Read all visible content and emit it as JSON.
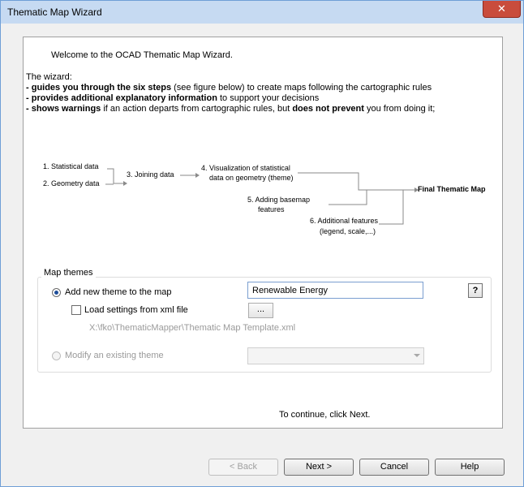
{
  "window": {
    "title": "Thematic Map Wizard",
    "close_glyph": "✕"
  },
  "welcome": "Welcome to the OCAD Thematic Map Wizard.",
  "intro": {
    "heading": "The wizard:",
    "line1_bold": "- guides you through the six steps",
    "line1_rest": " (see figure below) to create maps following the cartographic rules",
    "line2_bold": "- provides additional explanatory information",
    "line2_rest": " to support your decisions",
    "line3_bold1": "- shows warnings",
    "line3_mid": " if an action departs from cartographic rules, but ",
    "line3_bold2": "does not prevent",
    "line3_rest": " you from doing it;"
  },
  "diagram": {
    "step1": "1. Statistical data",
    "step2": "2. Geometry data",
    "step3": "3. Joining data",
    "step4_line1": "4. Visualization of statistical",
    "step4_line2": "data on geometry (theme)",
    "step5_line1": "5. Adding basemap",
    "step5_line2": "features",
    "step6_line1": "6. Additional features",
    "step6_line2": "(legend, scale,...)",
    "final": "Final Thematic Map"
  },
  "map_themes": {
    "legend": "Map themes",
    "add_new_label": "Add new theme to the map",
    "add_new_checked": true,
    "theme_name_value": "Renewable Energy",
    "help_label": "?",
    "load_settings_label": "Load settings from xml file",
    "load_settings_checked": false,
    "browse_label": "...",
    "template_path": "X:\\fko\\ThematicMapper\\Thematic Map Template.xml",
    "modify_label": "Modify an existing theme",
    "modify_checked": false,
    "existing_theme_value": ""
  },
  "continue_text": "To continue, click Next.",
  "buttons": {
    "back": "< Back",
    "next": "Next >",
    "cancel": "Cancel",
    "help": "Help"
  }
}
